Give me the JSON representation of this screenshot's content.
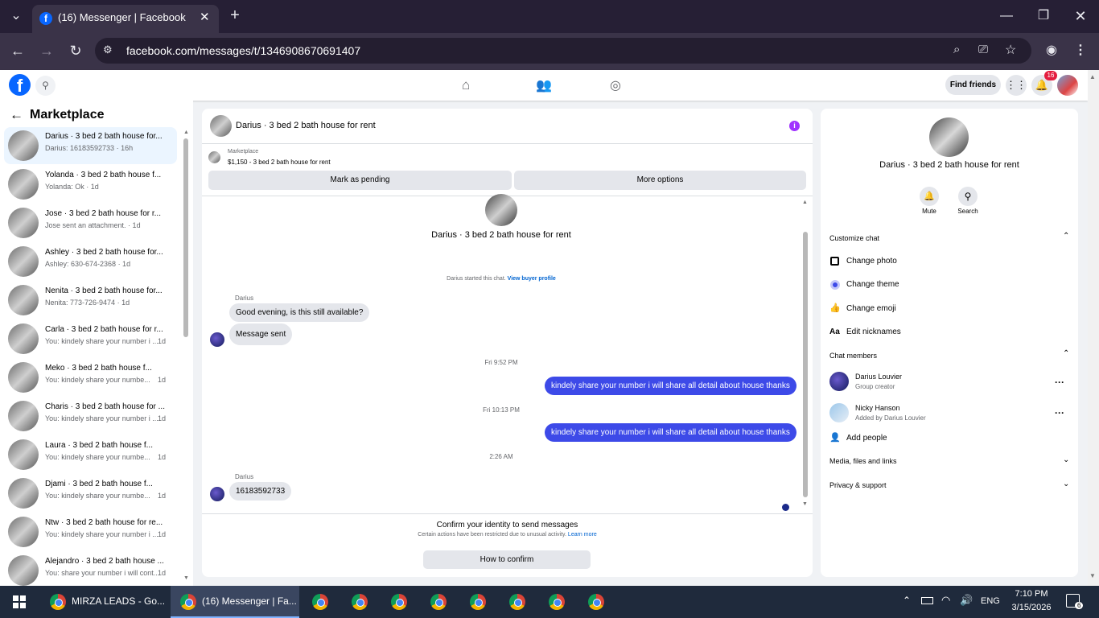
{
  "browser": {
    "tab_title": "(16) Messenger | Facebook",
    "url": "facebook.com/messages/t/1346908670691407",
    "new_tab": "+"
  },
  "header": {
    "find_friends": "Find friends",
    "notification_count": "16"
  },
  "sidebar": {
    "title": "Marketplace",
    "conversations": [
      {
        "title": "Darius · 3 bed 2 bath house for...",
        "preview": "Darius: 16183592733 · 16h",
        "selected": true
      },
      {
        "title": "Yolanda · 3 bed 2 bath house f...",
        "preview": "Yolanda: Ok · 1d"
      },
      {
        "title": "Jose · 3 bed 2 bath house for r...",
        "preview": "Jose sent an attachment. · 1d"
      },
      {
        "title": "Ashley · 3 bed 2 bath house for...",
        "preview": "Ashley: 630-674-2368 · 1d"
      },
      {
        "title": "Nenita · 3 bed 2 bath house for...",
        "preview": "Nenita: 773-726-9474 · 1d"
      },
      {
        "title": "Carla · 3 bed 2 bath house for r...",
        "preview": "You: kindely share your number i ...",
        "time": "1d"
      },
      {
        "title": "Meko · 3 bed 2 bath house f...",
        "preview": "You: kindely share your numbe...",
        "time": "1d"
      },
      {
        "title": "Charis · 3 bed 2 bath house for ...",
        "preview": "You: kindely share your number i ...",
        "time": "1d"
      },
      {
        "title": "Laura · 3 bed 2 bath house f...",
        "preview": "You: kindely share your numbe...",
        "time": "1d"
      },
      {
        "title": "Djami · 3 bed 2 bath house f...",
        "preview": "You: kindely share your numbe...",
        "time": "1d"
      },
      {
        "title": "Ntw · 3 bed 2 bath house for re...",
        "preview": "You: kindely share your number i ...",
        "time": "1d"
      },
      {
        "title": "Alejandro · 3 bed 2 bath house ...",
        "preview": "You: share your number i will cont...",
        "time": "1d"
      }
    ]
  },
  "chat": {
    "title": "Darius · 3 bed 2 bath house for rent",
    "listing_label": "Marketplace",
    "listing_price": "$1,150 - 3 bed 2 bath house for rent",
    "mark_pending": "Mark as pending",
    "more_options": "More options",
    "profile_name": "Darius · 3 bed 2 bath house for rent",
    "started_text": "Darius started this chat.",
    "view_buyer": "View buyer profile",
    "sender1": "Darius",
    "msg1": "Good evening, is this still available?",
    "msg2": "Message sent",
    "time1": "Fri 9:52 PM",
    "out1": "kindely share your number i will share all detail about house thanks",
    "time2": "Fri 10:13 PM",
    "out2": "kindely share your number i will share all detail about house thanks",
    "time3": "2:26 AM",
    "sender2": "Darius",
    "msg3": "16183592733",
    "confirm_title": "Confirm your identity to send messages",
    "confirm_desc": "Certain actions have been restricted due to unusual activity.",
    "learn_more": "Learn more",
    "how_confirm": "How to confirm"
  },
  "info": {
    "name": "Darius · 3 bed 2 bath house for rent",
    "mute": "Mute",
    "search": "Search",
    "customize": "Customize chat",
    "change_photo": "Change photo",
    "change_theme": "Change theme",
    "change_emoji": "Change emoji",
    "edit_nicknames": "Edit nicknames",
    "members": "Chat members",
    "member1_name": "Darius Louvier",
    "member1_role": "Group creator",
    "member2_name": "Nicky Hanson",
    "member2_role": "Added by Darius Louvier",
    "add_people": "Add people",
    "media": "Media, files and links",
    "privacy": "Privacy & support"
  },
  "taskbar": {
    "app1": "MIRZA LEADS - Go...",
    "app2": "(16) Messenger | Fa...",
    "lang": "ENG",
    "time": "7:10 PM",
    "date": "3/15/2026",
    "notif": "6"
  },
  "colors": {
    "accent": "#3d4ae8",
    "fb_blue": "#0866ff",
    "purple": "#a033ff"
  }
}
